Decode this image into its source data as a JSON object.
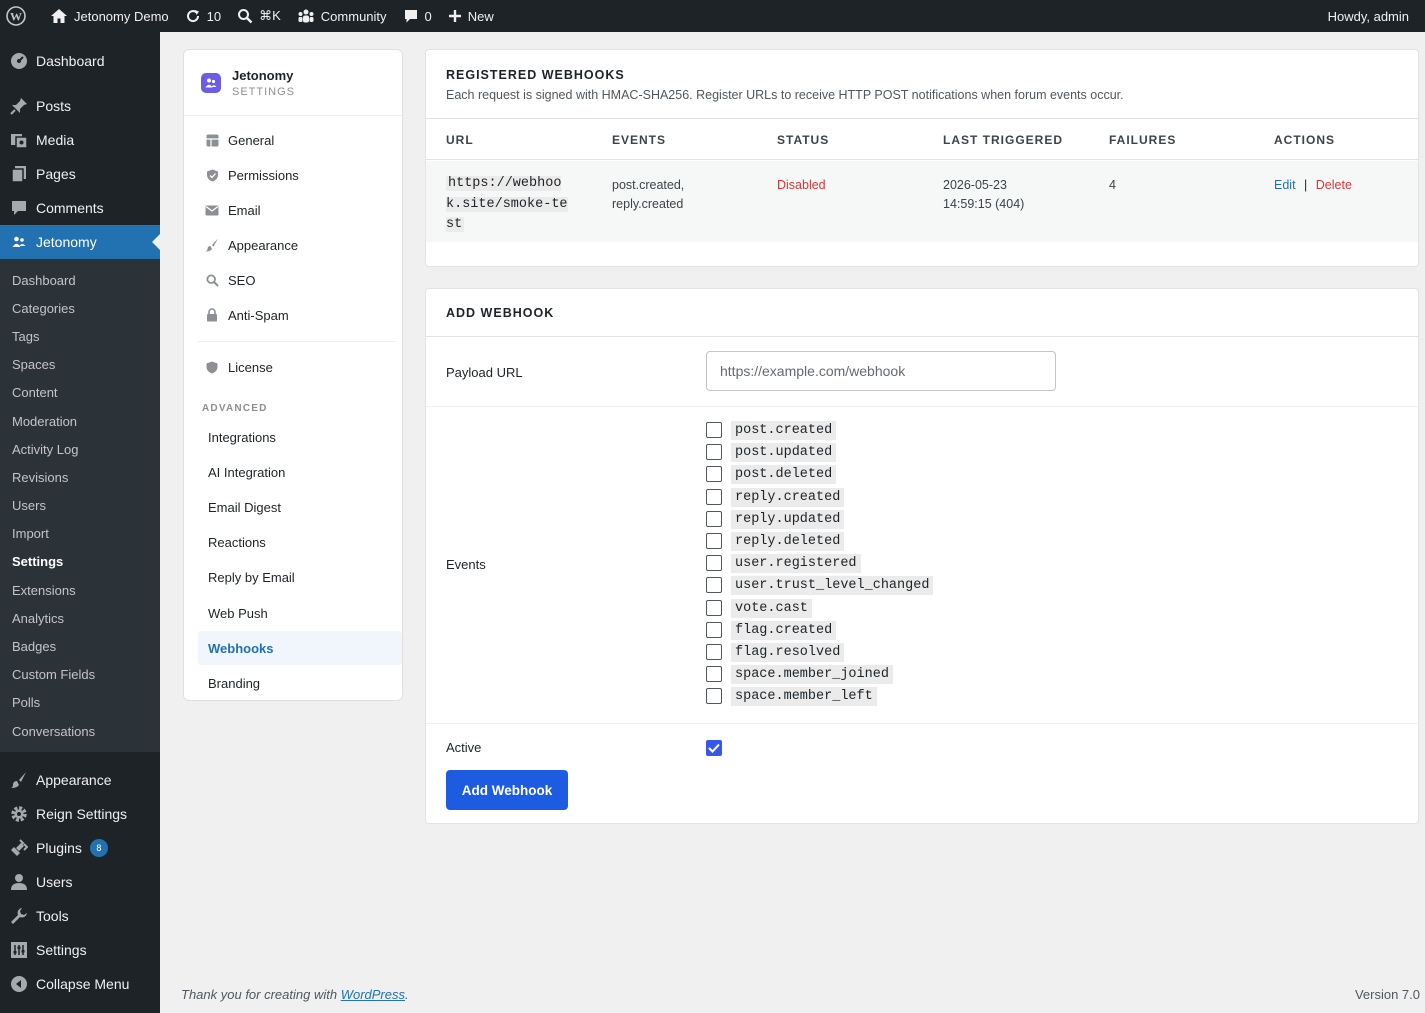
{
  "adminbar": {
    "site_name": "Jetonomy Demo",
    "updates_count": "10",
    "command_shortcut": "⌘K",
    "community": "Community",
    "comments_count": "0",
    "new_label": "New",
    "howdy": "Howdy, admin"
  },
  "sidebar": {
    "top": [
      {
        "label": "Dashboard",
        "icon": "dashboard-icon"
      },
      {
        "label": "Posts",
        "icon": "pin-icon"
      },
      {
        "label": "Media",
        "icon": "media-icon"
      },
      {
        "label": "Pages",
        "icon": "pages-icon"
      },
      {
        "label": "Comments",
        "icon": "comment-icon"
      },
      {
        "label": "Jetonomy",
        "icon": "people-icon"
      }
    ],
    "submenu": [
      "Dashboard",
      "Categories",
      "Tags",
      "Spaces",
      "Content",
      "Moderation",
      "Activity Log",
      "Revisions",
      "Users",
      "Import",
      "Settings",
      "Extensions",
      "Analytics",
      "Badges",
      "Custom Fields",
      "Polls",
      "Conversations"
    ],
    "bottom": [
      {
        "label": "Appearance",
        "icon": "brush-icon"
      },
      {
        "label": "Reign Settings",
        "icon": "gear-icon"
      },
      {
        "label": "Plugins",
        "icon": "plugin-icon",
        "badge": "8"
      },
      {
        "label": "Users",
        "icon": "user-icon"
      },
      {
        "label": "Tools",
        "icon": "wrench-icon"
      },
      {
        "label": "Settings",
        "icon": "settings-icon"
      },
      {
        "label": "Collapse Menu",
        "icon": "collapse-icon"
      }
    ]
  },
  "settings_nav": {
    "brand": "Jetonomy",
    "brand_sub": "SETTINGS",
    "items": [
      "General",
      "Permissions",
      "Email",
      "Appearance",
      "SEO",
      "Anti-Spam"
    ],
    "license": "License",
    "advanced_heading": "ADVANCED",
    "advanced_items": [
      "Integrations",
      "AI Integration",
      "Email Digest",
      "Reactions",
      "Reply by Email",
      "Web Push",
      "Webhooks",
      "Branding"
    ]
  },
  "webhooks": {
    "title": "REGISTERED WEBHOOKS",
    "description": "Each request is signed with HMAC-SHA256. Register URLs to receive HTTP POST notifications when forum events occur.",
    "columns": [
      "URL",
      "EVENTS",
      "STATUS",
      "LAST TRIGGERED",
      "FAILURES",
      "ACTIONS"
    ],
    "rows": [
      {
        "url": "https://webhook.site/smoke-test",
        "events_line1": "post.created,",
        "events_line2": "reply.created",
        "status": "Disabled",
        "last_triggered_line1": "2026-05-23",
        "last_triggered_line2": "14:59:15 (404)",
        "failures": "4",
        "edit": "Edit",
        "separator": "|",
        "delete": "Delete"
      }
    ]
  },
  "add_webhook": {
    "title": "ADD WEBHOOK",
    "payload_label": "Payload URL",
    "payload_placeholder": "https://example.com/webhook",
    "events_label": "Events",
    "events": [
      "post.created",
      "post.updated",
      "post.deleted",
      "reply.created",
      "reply.updated",
      "reply.deleted",
      "user.registered",
      "user.trust_level_changed",
      "vote.cast",
      "flag.created",
      "flag.resolved",
      "space.member_joined",
      "space.member_left"
    ],
    "active_label": "Active",
    "active_checked": true,
    "submit_label": "Add Webhook"
  },
  "footer": {
    "thanks_prefix": "Thank you for creating with ",
    "thanks_link": "WordPress",
    "thanks_suffix": ".",
    "version": "Version 7.0"
  }
}
